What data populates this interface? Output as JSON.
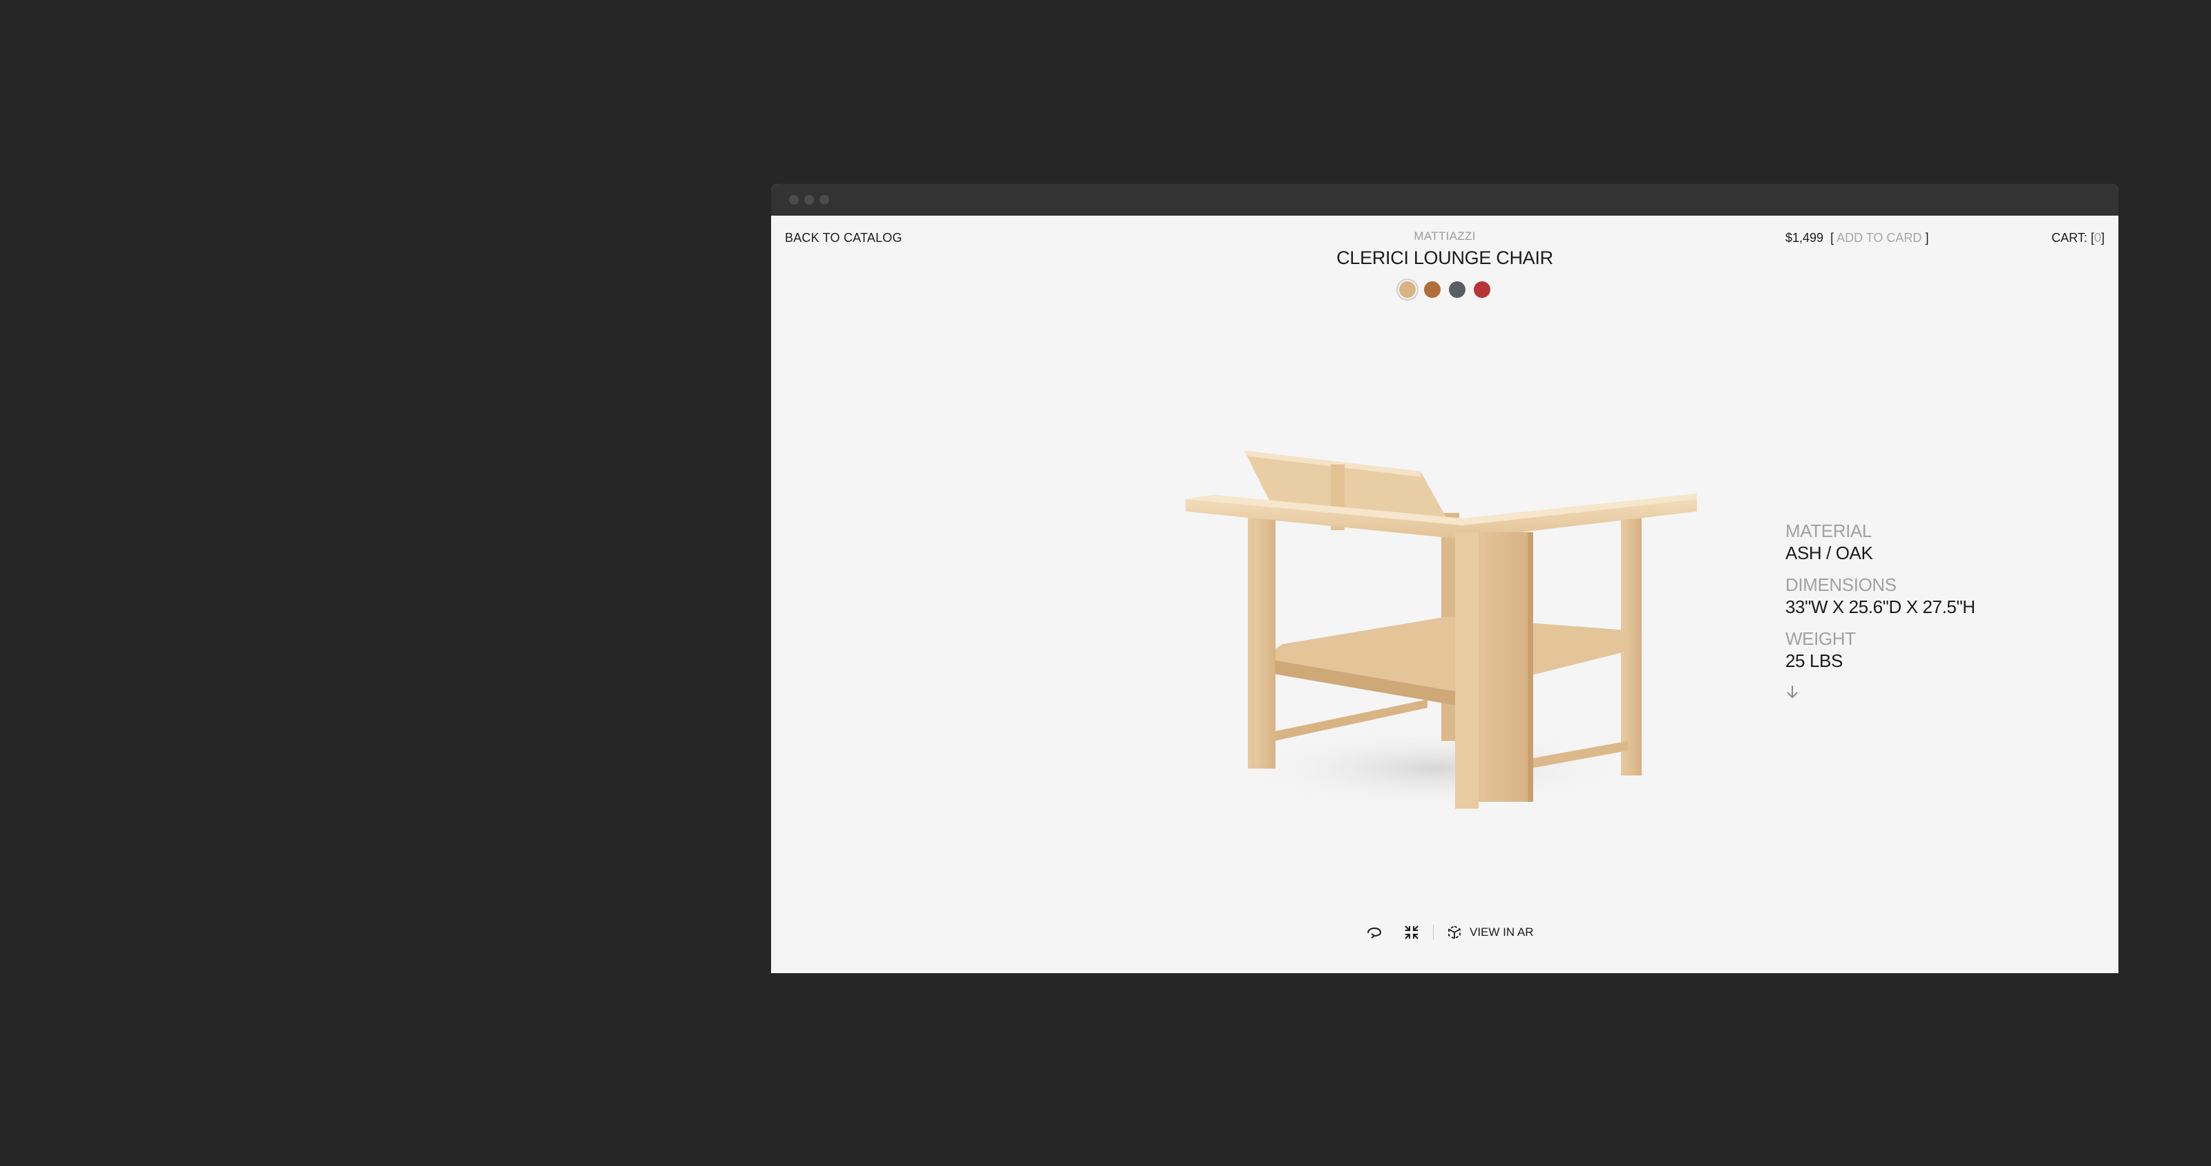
{
  "header": {
    "back_label": "BACK TO CATALOG",
    "brand": "MATTIAZZI",
    "title": "CLERICI LOUNGE CHAIR",
    "price": "$1,499",
    "add_label": "ADD TO CARD",
    "cart_label": "CART:",
    "cart_count": "0"
  },
  "swatches": [
    {
      "name": "natural-ash",
      "color": "#d8b384",
      "selected": true
    },
    {
      "name": "walnut-brown",
      "color": "#b06e3b",
      "selected": false
    },
    {
      "name": "slate-grey",
      "color": "#5a5e62",
      "selected": false
    },
    {
      "name": "red",
      "color": "#b83535",
      "selected": false
    }
  ],
  "specs": [
    {
      "label": "MATERIAL",
      "value": "ASH / OAK"
    },
    {
      "label": "DIMENSIONS",
      "value": "33\"W X 25.6\"D X 27.5\"H"
    },
    {
      "label": "WEIGHT",
      "value": "25 LBS"
    }
  ],
  "toolbar": {
    "rotate_icon": "rotate-icon",
    "fullscreen_icon": "collapse-icon",
    "ar_icon": "ar-cube-icon",
    "ar_label": "VIEW IN AR"
  },
  "colors": {
    "background": "#262626",
    "page": "#f5f5f5",
    "titlebar": "#333333",
    "muted_text": "#a2a2a2",
    "text": "#1b1b1b",
    "wood_light": "#ecd2ab",
    "wood_mid": "#dcb98a",
    "wood_dark": "#c89f6e"
  }
}
